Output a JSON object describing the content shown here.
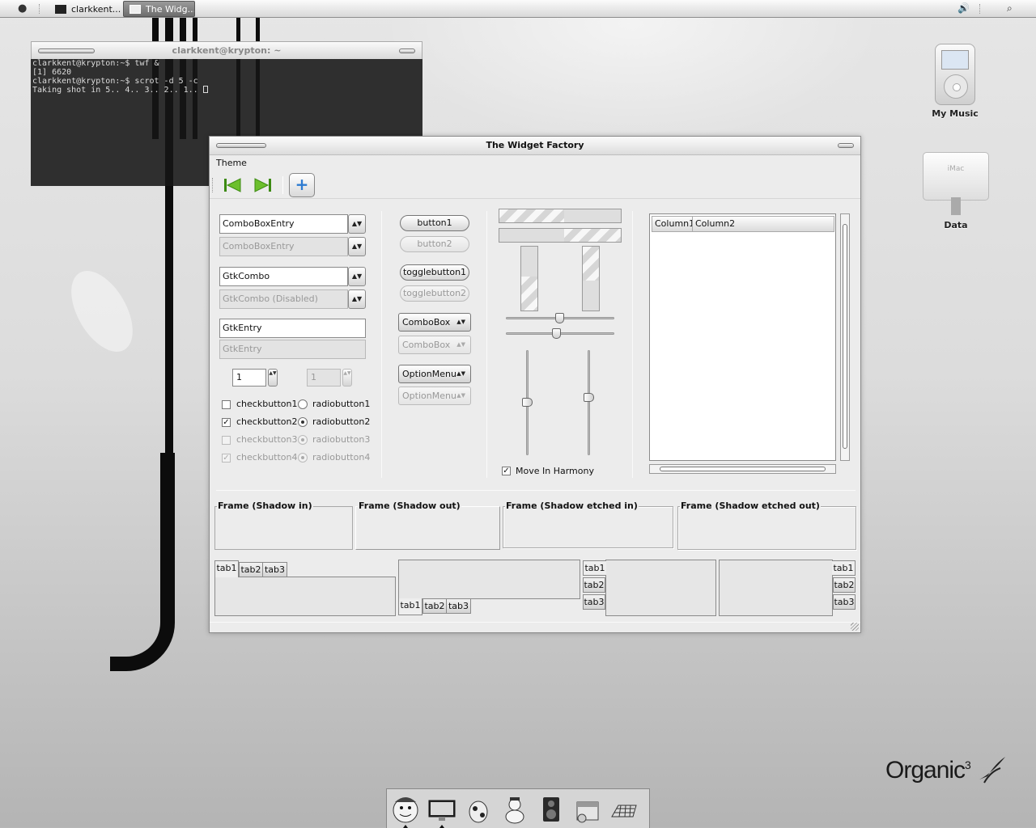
{
  "top_panel": {
    "apple_icon": "apple-icon",
    "tasks": [
      {
        "label": "clarkkent...",
        "icon": "terminal-icon",
        "active": false
      },
      {
        "label": "The Widg...",
        "icon": "window-icon",
        "active": true
      }
    ],
    "volume_icon": "speaker-icon",
    "search_icon": "magnifier-icon"
  },
  "terminal": {
    "title": "clarkkent@krypton: ~",
    "lines": [
      "clarkkent@krypton:~$ twf &",
      "[1] 6620",
      "clarkkent@krypton:~$ scrot -d 5 -c",
      "Taking shot in 5.. 4.. 3.. 2.. 1.. "
    ]
  },
  "desktop_icons": [
    {
      "label": "My Music",
      "icon": "ipod-icon"
    },
    {
      "label": "Data",
      "icon": "imac-icon",
      "screen_text": "iMac"
    }
  ],
  "widget_factory": {
    "title": "The Widget Factory",
    "menu": [
      "Theme"
    ],
    "toolbar": {
      "first_icon": "goto-first-icon",
      "last_icon": "goto-last-icon",
      "add_icon": "add-icon",
      "add_symbol": "+"
    },
    "col1": {
      "combobox_entry": "ComboBoxEntry",
      "combobox_entry_disabled": "ComboBoxEntry",
      "gtk_combo": "GtkCombo",
      "gtk_combo_disabled": "GtkCombo (Disabled)",
      "gtk_entry": "GtkEntry",
      "gtk_entry_disabled": "GtkEntry",
      "spin_value": "1",
      "spin_value_disabled": "1",
      "checkbuttons": [
        {
          "label": "checkbutton1",
          "checked": false,
          "disabled": false
        },
        {
          "label": "checkbutton2",
          "checked": true,
          "disabled": false
        },
        {
          "label": "checkbutton3",
          "checked": false,
          "disabled": true
        },
        {
          "label": "checkbutton4",
          "checked": true,
          "disabled": true
        }
      ],
      "radiobuttons": [
        {
          "label": "radiobutton1",
          "selected": false,
          "disabled": false
        },
        {
          "label": "radiobutton2",
          "selected": true,
          "disabled": false
        },
        {
          "label": "radiobutton3",
          "selected": true,
          "disabled": true
        },
        {
          "label": "radiobutton4",
          "selected": true,
          "disabled": true
        }
      ],
      "check_mark": "✓",
      "arrow_glyph": "▲▼"
    },
    "col2": {
      "button1": "button1",
      "button2": "button2",
      "togglebutton1": "togglebutton1",
      "togglebutton2": "togglebutton2",
      "combobox": "ComboBox",
      "combobox_disabled": "ComboBox",
      "optionmenu": "OptionMenu",
      "optionmenu_disabled": "OptionMenu"
    },
    "col3": {
      "progress_h1": 0.53,
      "progress_h2": 0.47,
      "progress_v1": 0.53,
      "progress_v2": 0.53,
      "hscale1": 0.5,
      "hscale2": 0.47,
      "vscale1": 0.5,
      "vscale2": 0.45,
      "move_in_harmony": "Move In Harmony",
      "move_in_harmony_checked": true
    },
    "col4": {
      "columns": [
        "Column1",
        "Column2"
      ]
    },
    "frames": [
      "Frame (Shadow in)",
      "Frame (Shadow out)",
      "Frame (Shadow etched in)",
      "Frame (Shadow etched out)"
    ],
    "notebooks": {
      "tabs": [
        "tab1",
        "tab2",
        "tab3"
      ]
    }
  },
  "dock": {
    "items": [
      "finder-face-icon",
      "display-icon",
      "cow-icon",
      "snowman-icon",
      "speaker-box-icon",
      "installer-icon",
      "chessboard-icon"
    ]
  },
  "brand": {
    "name": "Organic",
    "sup": "3"
  },
  "colors": {
    "window_bg": "#ececec",
    "accent_blue": "#2e7bd1",
    "toolbar_green": "#5aa51e"
  }
}
